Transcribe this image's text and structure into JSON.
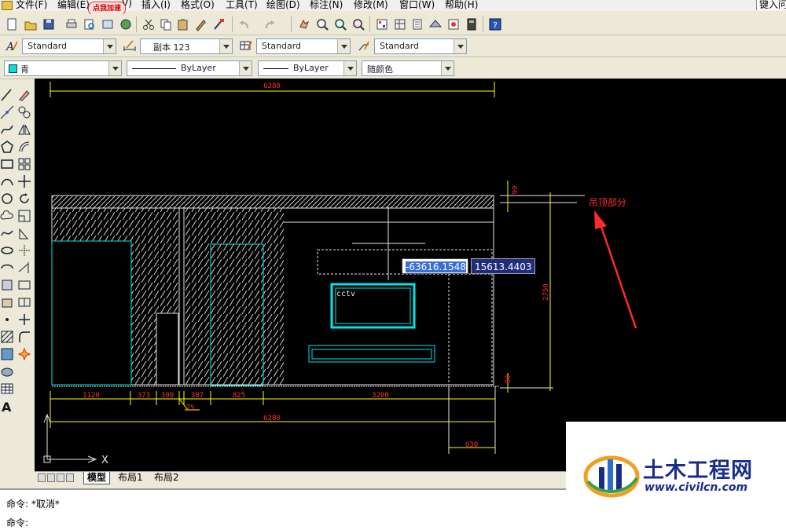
{
  "menubar": {
    "items": [
      "文件(F)",
      "编辑(E)",
      "V)",
      "插入(I)",
      "格式(O)",
      "工具(T)",
      "绘图(D)",
      "标注(N)",
      "修改(M)",
      "窗口(W)",
      "帮助(H)"
    ],
    "help_hint": "键入问",
    "speedup_badge": "点我加速"
  },
  "styles_toolbar": {
    "text_style": "Standard",
    "dim_style": "副本 123",
    "table_style": "Standard",
    "multileader_style": "Standard"
  },
  "properties_toolbar": {
    "layer": "青",
    "layer_color": "#00e0e0",
    "linetype": "ByLayer",
    "lineweight": "ByLayer",
    "plot_color": "随颜色"
  },
  "drawing": {
    "dims": {
      "top_overall": "6280",
      "bottom_overall": "6280",
      "seg1": "1120",
      "seg2": "373",
      "seg3": "300",
      "seg4": "387",
      "seg5": "825",
      "seg6": "3200",
      "small_75": "75",
      "right_630": "630",
      "height_2750": "2750",
      "top_90": "90",
      "bottom_90": "90"
    },
    "tv_label": "cctv",
    "annotation": "吊顶部分",
    "annotation_color": "#ff2a2a",
    "ucs_x_label": "X",
    "colors": {
      "line": "#e6e6e6",
      "cyan": "#00e5e5",
      "dim": "#ffff00",
      "dim_text": "#ff3030"
    }
  },
  "coord_input": {
    "x": "-63616.1548",
    "y": "15613.4403"
  },
  "layout_tabs": [
    "模型",
    "布局1",
    "布局2"
  ],
  "command": {
    "line1": "命令: *取消*",
    "line2": "命令:"
  },
  "watermark": {
    "name": "土木工程网",
    "url": "www.civilcn.com"
  }
}
